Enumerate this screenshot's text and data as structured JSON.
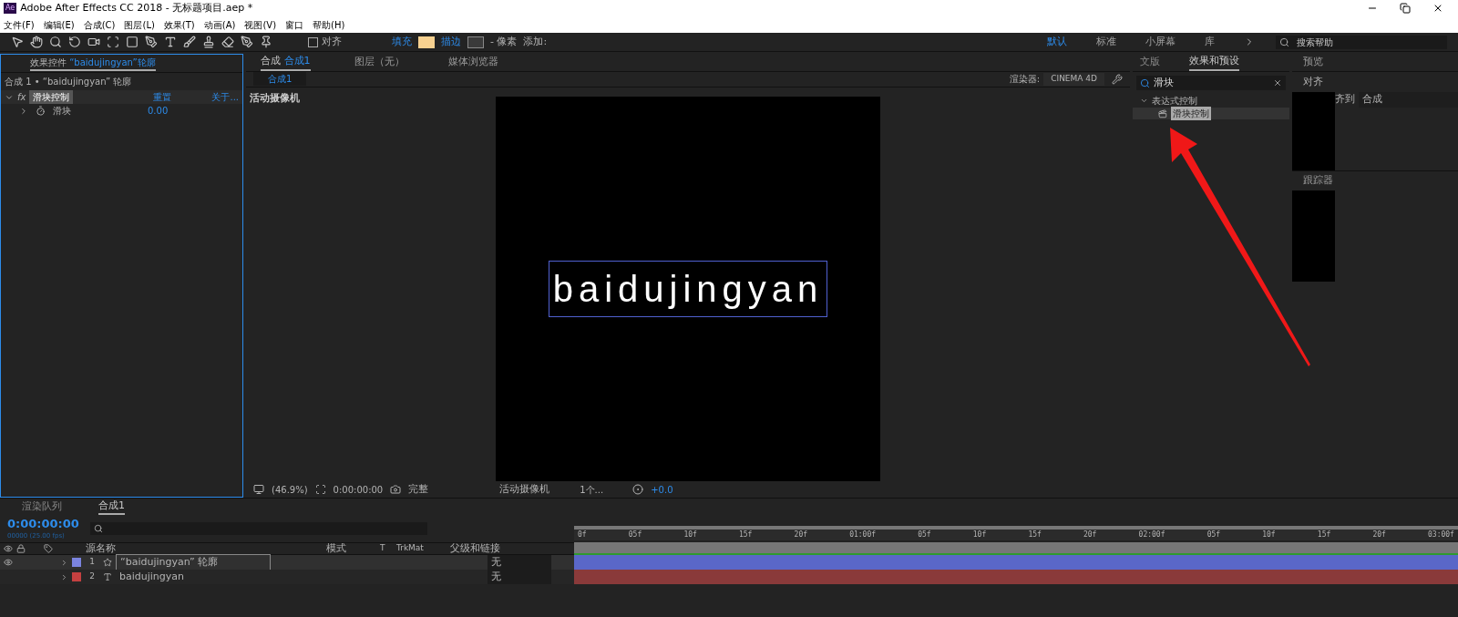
{
  "title_bar": {
    "app_badge": "Ae",
    "title": "Adobe After Effects CC 2018 - 无标题项目.aep *"
  },
  "menu": [
    "文件(F)",
    "编辑(E)",
    "合成(C)",
    "图层(L)",
    "效果(T)",
    "动画(A)",
    "视图(V)",
    "窗口",
    "帮助(H)"
  ],
  "toolbar": {
    "align_checked": false,
    "align_label": "对齐",
    "fill_label": "填充",
    "stroke_label": "描边",
    "pixel_label": "- 像素",
    "add_label": "添加:",
    "workspaces": [
      {
        "label": "默认",
        "selected": true
      },
      {
        "label": "标准",
        "selected": false
      },
      {
        "label": "小屏幕",
        "selected": false
      },
      {
        "label": "库",
        "selected": false
      }
    ],
    "search_placeholder": "搜索帮助"
  },
  "effect_controls": {
    "tab_prefix": "效果控件",
    "tab_layer": "“baidujingyan”轮廓",
    "breadcrumb": "合成 1 • “baidujingyan” 轮廓",
    "effect": {
      "fx_label": "fx",
      "name": "滑块控制",
      "reset": "重置",
      "about": "关于...",
      "expanded": true
    },
    "property": {
      "name": "滑块",
      "value": "0.00",
      "expanded": false
    }
  },
  "composition": {
    "tabs": [
      {
        "prefix": "合成",
        "label": "合成1",
        "selected": true
      },
      {
        "label": "图层（无）",
        "selected": false
      },
      {
        "label": "媒体浏览器",
        "selected": false
      }
    ],
    "sub_tab": "合成1",
    "renderer_label": "渲染器:",
    "renderer": "CINEMA 4D",
    "camera_label": "活动摄像机",
    "canvas_text": "baidujingyan",
    "footer": {
      "zoom": "(46.9%)",
      "time": "0:00:00:00",
      "resolution": "完整",
      "view": "活动摄像机",
      "view_count": "1个...",
      "exposure": "+0.0"
    }
  },
  "effects_presets": {
    "tabs": [
      {
        "label": "文版",
        "selected": false
      },
      {
        "label": "效果和预设",
        "selected": true
      }
    ],
    "search": "滑块",
    "tree": [
      {
        "label": "表达式控制",
        "expanded": true,
        "children": [
          {
            "label": "滑块控制",
            "selected": true
          }
        ]
      }
    ]
  },
  "right_panels": {
    "preview_title": "预览",
    "align_title": "对齐",
    "align_to_label": "齐到",
    "align_to_value": "合成",
    "tracker_title": "跟踪器"
  },
  "timeline": {
    "tabs": [
      {
        "label": "渲染队列",
        "selected": false
      },
      {
        "label": "合成1",
        "selected": true
      }
    ],
    "timecode": "0:00:00:00",
    "fps": "00000 (25.00 fps)",
    "columns": {
      "source_name": "源名称",
      "mode": "模式",
      "t": "T",
      "trkmat": "TrkMat",
      "parent": "父级和链接"
    },
    "layers": [
      {
        "number": "1",
        "kind": "shape",
        "name": "“baidujingyan” 轮廓",
        "color": "#7b84e0",
        "selected": true,
        "parent": "无"
      },
      {
        "number": "2",
        "kind": "text",
        "name": "baidujingyan",
        "color": "#c44040",
        "selected": false,
        "parent": "无"
      }
    ],
    "ticks": [
      "0f",
      "05f",
      "10f",
      "15f",
      "20f",
      "01:00f",
      "05f",
      "10f",
      "15f",
      "20f",
      "02:00f",
      "05f",
      "10f",
      "15f",
      "20f",
      "03:00f"
    ]
  }
}
